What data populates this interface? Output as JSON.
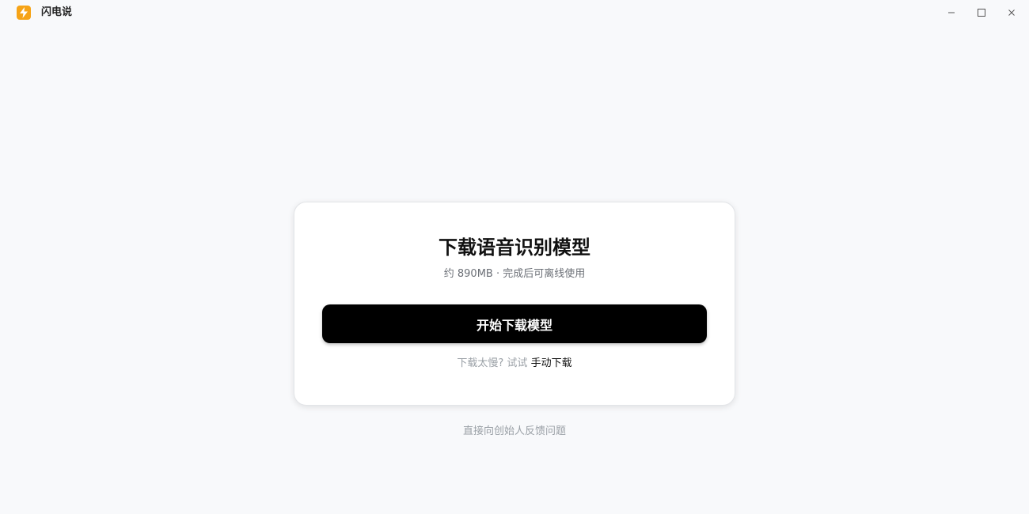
{
  "app": {
    "title": "闪电说",
    "logo_icon": "lightning-bolt-icon",
    "accent": "#f6a316"
  },
  "window_controls": {
    "minimize": "minimize-icon",
    "maximize": "maximize-icon",
    "close": "close-icon"
  },
  "card": {
    "title": "下载语音识别模型",
    "subtitle": "约 890MB · 完成后可离线使用",
    "primary_button_label": "开始下载模型",
    "slow_prefix": "下载太慢? 试试",
    "manual_link_label": "手动下载"
  },
  "footer": {
    "feedback_label": "直接向创始人反馈问题"
  }
}
